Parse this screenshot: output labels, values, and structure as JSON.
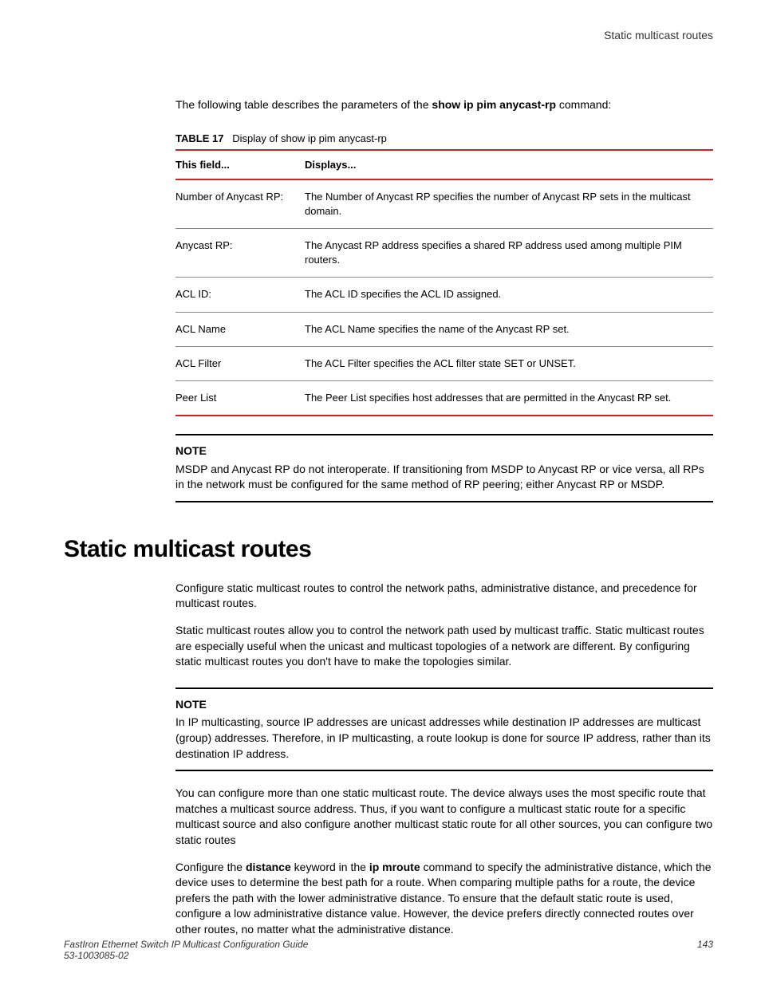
{
  "header": {
    "title": "Static multicast routes"
  },
  "intro": {
    "prefix": "The following table describes the parameters of the ",
    "cmd": "show ip pim anycast-rp",
    "suffix": " command:"
  },
  "table": {
    "label_num": "TABLE 17",
    "label_text": "Display of show ip pim anycast-rp",
    "col1": "This field...",
    "col2": "Displays...",
    "rows": [
      {
        "f": "Number of Anycast RP:",
        "d": "The Number of Anycast RP specifies the number of Anycast RP sets in the multicast domain."
      },
      {
        "f": "Anycast RP:",
        "d": "The Anycast RP address specifies a shared RP address used among multiple PIM routers."
      },
      {
        "f": "ACL ID:",
        "d": "The ACL ID specifies the ACL ID assigned."
      },
      {
        "f": "ACL Name",
        "d": "The ACL Name specifies the name of the Anycast RP set."
      },
      {
        "f": "ACL Filter",
        "d": "The ACL Filter specifies the ACL filter state SET or UNSET."
      },
      {
        "f": "Peer List",
        "d": "The Peer List specifies host addresses that are permitted in the Anycast RP set."
      }
    ]
  },
  "note1": {
    "label": "NOTE",
    "text": "MSDP and Anycast RP do not interoperate. If transitioning from MSDP to Anycast RP or vice versa, all RPs in the network must be configured for the same method of RP peering; either Anycast RP or MSDP."
  },
  "section": {
    "heading": "Static multicast routes",
    "p1": "Configure static multicast routes to control the network paths, administrative distance, and precedence for multicast routes.",
    "p2": "Static multicast routes allow you to control the network path used by multicast traffic. Static multicast routes are especially useful when the unicast and multicast topologies of a network are different. By configuring static multicast routes you don't have to make the topologies similar."
  },
  "note2": {
    "label": "NOTE",
    "text": "In IP multicasting, source IP addresses are unicast addresses while destination IP addresses are multicast (group) addresses. Therefore, in IP multicasting, a route lookup is done for source IP address, rather than its destination IP address."
  },
  "p3": "You can configure more than one static multicast route. The device always uses the most specific route that matches a multicast source address. Thus, if you want to configure a multicast static route for a specific multicast source and also configure another multicast static route for all other sources, you can configure two static routes",
  "p4": {
    "a": "Configure the ",
    "b": "distance",
    "c": " keyword in the ",
    "d": "ip mroute",
    "e": " command to specify the administrative distance, which the device uses to determine the best path for a route. When comparing multiple paths for a route, the device prefers the path with the lower administrative distance. To ensure that the default static route is used, configure a low administrative distance value. However, the device prefers directly connected routes over other routes, no matter what the administrative distance."
  },
  "footer": {
    "title": "FastIron Ethernet Switch IP Multicast Configuration Guide",
    "docnum": "53-1003085-02",
    "page": "143"
  }
}
